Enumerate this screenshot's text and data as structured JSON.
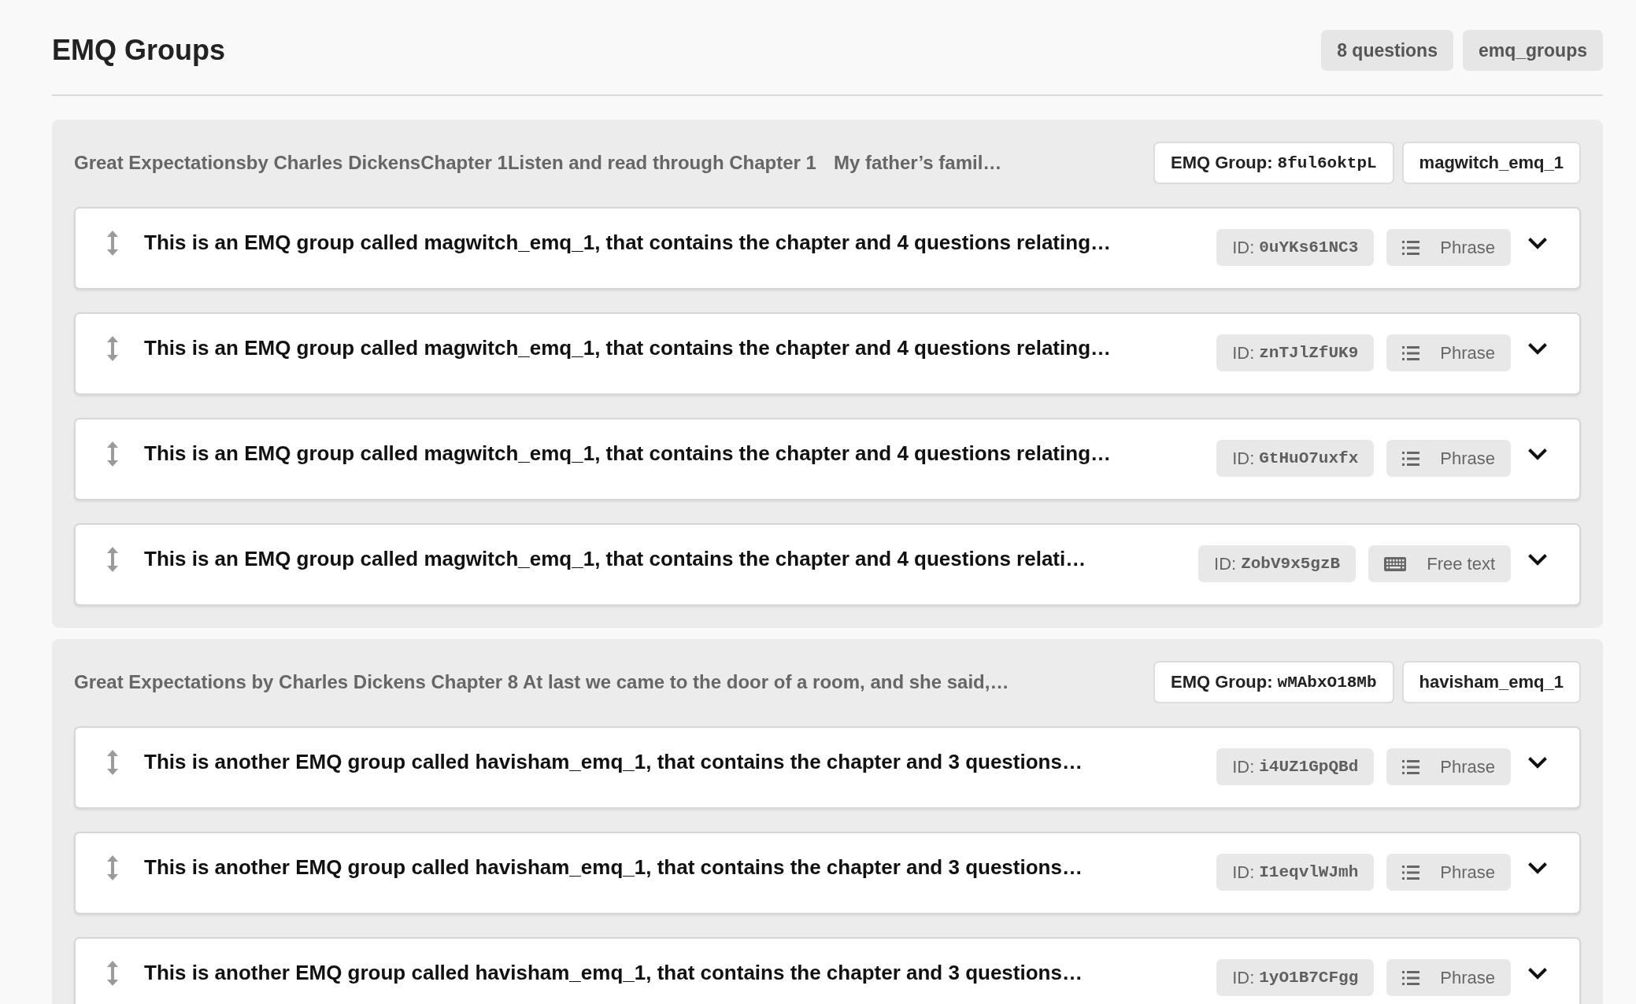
{
  "header": {
    "title": "EMQ Groups",
    "tags": [
      "8 questions",
      "emq_groups"
    ]
  },
  "groups": [
    {
      "summary": [
        "Great Expectationsby Charles DickensChapter 1Listen and read through Chapter 1",
        "My father’s famil…"
      ],
      "group_label": "EMQ Group:",
      "group_id": "8ful6oktpL",
      "name": "magwitch_emq_1",
      "questions": [
        {
          "text": "This is an EMQ group called magwitch_emq_1, that contains the chapter and 4 questions relating…",
          "id_label": "ID:",
          "id": "0uYKs61NC3",
          "kind": "phrase",
          "type_label": "Phrase",
          "expanded": false
        },
        {
          "text": "This is an EMQ group called magwitch_emq_1, that contains the chapter and 4 questions relating…",
          "id_label": "ID:",
          "id": "znTJlZfUK9",
          "kind": "phrase",
          "type_label": "Phrase",
          "expanded": false
        },
        {
          "text": "This is an EMQ group called magwitch_emq_1, that contains the chapter and 4 questions relating…",
          "id_label": "ID:",
          "id": "GtHuO7uxfx",
          "kind": "phrase",
          "type_label": "Phrase",
          "expanded": false
        },
        {
          "text": "This is an EMQ group called magwitch_emq_1, that contains the chapter and 4 questions relati…",
          "id_label": "ID:",
          "id": "ZobV9x5gzB",
          "kind": "free_text",
          "type_label": "Free text",
          "expanded": false
        }
      ]
    },
    {
      "summary": [
        "Great Expectations by Charles Dickens Chapter 8 At last we came to the door of a room, and she said,…"
      ],
      "group_label": "EMQ Group:",
      "group_id": "wMAbxO18Mb",
      "name": "havisham_emq_1",
      "questions": [
        {
          "text": "This is another EMQ group called havisham_emq_1, that contains the chapter and 3 questions…",
          "id_label": "ID:",
          "id": "i4UZ1GpQBd",
          "kind": "phrase",
          "type_label": "Phrase",
          "expanded": false
        },
        {
          "text": "This is another EMQ group called havisham_emq_1, that contains the chapter and 3 questions…",
          "id_label": "ID:",
          "id": "I1eqvlWJmh",
          "kind": "phrase",
          "type_label": "Phrase",
          "expanded": false
        },
        {
          "text": "This is another EMQ group called havisham_emq_1, that contains the chapter and 3 questions…",
          "id_label": "ID:",
          "id": "1yO1B7CFgg",
          "kind": "phrase",
          "type_label": "Phrase",
          "expanded": false
        }
      ]
    }
  ]
}
